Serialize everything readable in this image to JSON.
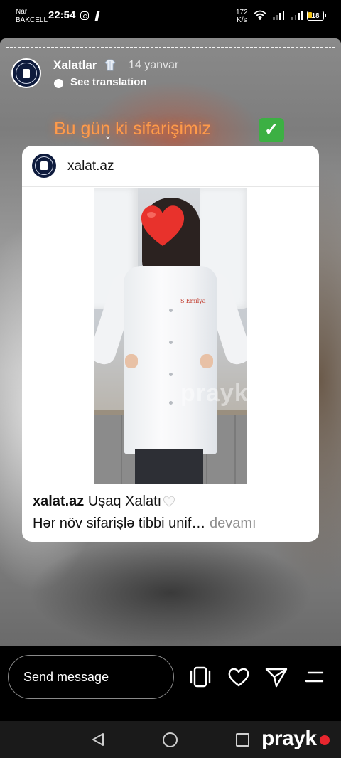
{
  "status_bar": {
    "carrier_line1": "Nar",
    "carrier_line2": "BAKCELL",
    "time": "22:54",
    "net_speed_value": "172",
    "net_speed_unit": "K/s",
    "battery": "18"
  },
  "story": {
    "account_name": "Xalatlar",
    "date": "14 yanvar",
    "translate_label": "See translation",
    "caption": "Bu gün ki sifarişimiz",
    "caption_emoji": "✓"
  },
  "shared_post": {
    "username": "xalat.az",
    "embroidery": "S.Emilya",
    "caption_user": "xalat.az",
    "caption_title": "Uşaq Xalatı",
    "caption_line2": "Hər növ sifarişlə tibbi unif…",
    "more_label": "devamı",
    "watermark": "prayk"
  },
  "reply_bar": {
    "input_placeholder": "Send message"
  },
  "nav": {
    "brand": "prayk"
  },
  "icons": {
    "instagram_status": "instagram-icon",
    "wifi": "wifi-icon",
    "multi": "carousel-icon",
    "like": "heart-outline-icon",
    "share": "send-icon",
    "menu": "menu-icon"
  },
  "colors": {
    "caption_orange": "#ff9b4a",
    "check_green": "#3cb043",
    "brand_red": "#e8262e",
    "heart_red": "#e8322c"
  }
}
